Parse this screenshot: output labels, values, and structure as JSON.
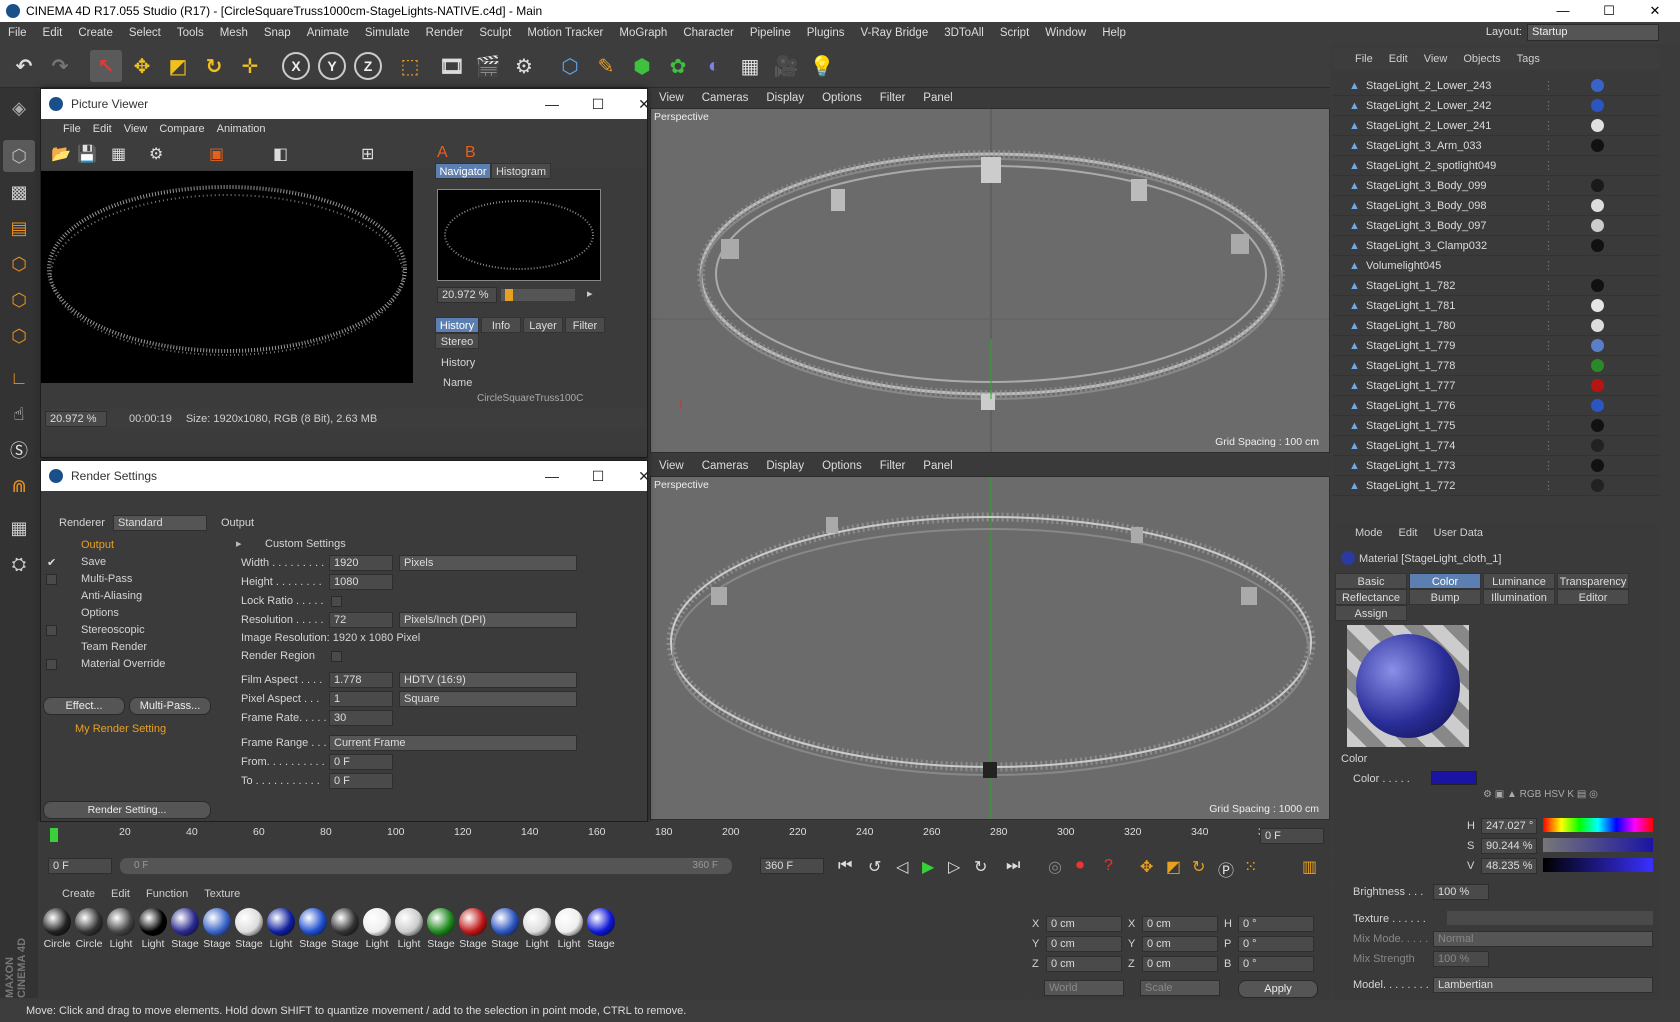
{
  "app": {
    "title": "CINEMA 4D R17.055 Studio (R17) - [CircleSquareTruss1000cm-StageLights-NATIVE.c4d] - Main",
    "min": "—",
    "max": "☐",
    "close": "✕"
  },
  "menu": [
    "File",
    "Edit",
    "Create",
    "Select",
    "Tools",
    "Mesh",
    "Snap",
    "Animate",
    "Simulate",
    "Render",
    "Sculpt",
    "Motion Tracker",
    "MoGraph",
    "Character",
    "Pipeline",
    "Plugins",
    "V-Ray Bridge",
    "3DToAll",
    "Script",
    "Window",
    "Help"
  ],
  "layout": {
    "label": "Layout:",
    "value": "Startup"
  },
  "toolbar": {
    "x": "X",
    "y": "Y",
    "z": "Z"
  },
  "viewport_top": {
    "menu": [
      "View",
      "Cameras",
      "Display",
      "Options",
      "Filter",
      "Panel"
    ],
    "label": "Perspective",
    "grid": "Grid Spacing : 100 cm"
  },
  "viewport_bottom": {
    "menu": [
      "View",
      "Cameras",
      "Display",
      "Options",
      "Filter",
      "Panel"
    ],
    "label": "Perspective",
    "grid": "Grid Spacing : 1000 cm"
  },
  "picture_viewer": {
    "title": "Picture Viewer",
    "menu": [
      "File",
      "Edit",
      "View",
      "Compare",
      "Animation"
    ],
    "tabs": [
      "Navigator",
      "Histogram"
    ],
    "zoom": "20.972 %",
    "tabs2": [
      "History",
      "Info",
      "Layer",
      "Filter"
    ],
    "stereo": "Stereo",
    "history": "History",
    "name_col": "Name",
    "history_item": "CircleSquareTruss100C",
    "status_zoom": "20.972 %",
    "status_time": "00:00:19",
    "status_size": "Size: 1920x1080, RGB (8 Bit), 2.63 MB",
    "min": "—",
    "max": "☐",
    "close": "✕"
  },
  "render_settings": {
    "title": "Render Settings",
    "renderer_label": "Renderer",
    "renderer": "Standard",
    "tree": [
      "Output",
      "Save",
      "Multi-Pass",
      "Anti-Aliasing",
      "Options",
      "Stereoscopic",
      "Team Render",
      "Material Override"
    ],
    "effect_btn": "Effect...",
    "multipass_btn": "Multi-Pass...",
    "my_setting": "My Render Setting",
    "render_setting_btn": "Render Setting...",
    "section": "Output",
    "custom": "Custom Settings",
    "width_lbl": "Width . . . . . . . . .",
    "width": "1920",
    "width_unit": "Pixels",
    "height_lbl": "Height . . . . . . . .",
    "height": "1080",
    "lock_lbl": "Lock Ratio . . . . .",
    "res_lbl": "Resolution . . . . .",
    "res": "72",
    "res_unit": "Pixels/Inch (DPI)",
    "image_res": "Image Resolution:  1920 x 1080 Pixel",
    "region_lbl": "Render Region",
    "film_lbl": "Film Aspect . . . .",
    "film": "1.778",
    "film_sel": "HDTV (16:9)",
    "pixel_lbl": "Pixel Aspect . . .",
    "pixel": "1",
    "pixel_sel": "Square",
    "fps_lbl": "Frame Rate. . . . .",
    "fps": "30",
    "range_lbl": "Frame Range . . . .",
    "range": "Current Frame",
    "from_lbl": "From. . . . . . . . . .",
    "from": "0 F",
    "to_lbl": "To . . . . . . . . . . .",
    "to": "0 F",
    "min": "—",
    "max": "☐",
    "close": "✕"
  },
  "objects": {
    "menu": [
      "File",
      "Edit",
      "View",
      "Objects",
      "Tags"
    ],
    "items": [
      "StageLight_2_Lower_243",
      "StageLight_2_Lower_242",
      "StageLight_2_Lower_241",
      "StageLight_3_Arm_033",
      "StageLight_2_spotlight049",
      "StageLight_3_Body_099",
      "StageLight_3_Body_098",
      "StageLight_3_Body_097",
      "StageLight_3_Clamp032",
      "Volumelight045",
      "StageLight_1_782",
      "StageLight_1_781",
      "StageLight_1_780",
      "StageLight_1_779",
      "StageLight_1_778",
      "StageLight_1_777",
      "StageLight_1_776",
      "StageLight_1_775",
      "StageLight_1_774",
      "StageLight_1_773",
      "StageLight_1_772"
    ],
    "tag_colors": [
      "#3a63c8",
      "#2b55c0",
      "#e0e0e0",
      "#111111",
      "",
      "#1a1a1a",
      "#dddddd",
      "#cccccc",
      "#111111",
      "",
      "#111111",
      "#e5e5e5",
      "#dddddd",
      "#5a7fc8",
      "#2a8a2a",
      "#b81414",
      "#2b55c0",
      "#111111",
      "#222222",
      "#111111",
      "#222222"
    ]
  },
  "attributes": {
    "menu": [
      "Mode",
      "Edit",
      "User Data"
    ],
    "material": "Material [StageLight_cloth_1]",
    "tabs": [
      "Basic",
      "Color",
      "Luminance",
      "Transparency",
      "Reflectance",
      "Bump",
      "Illumination",
      "Editor",
      "Assign"
    ],
    "section": "Color",
    "color_lbl": "Color . . . . .",
    "h_lbl": "H",
    "h": "247.027 °",
    "s_lbl": "S",
    "s": "90.244 %",
    "v_lbl": "V",
    "v": "48.235 %",
    "brightness_lbl": "Brightness . . .",
    "brightness": "100 %",
    "texture_lbl": "Texture . . . . . .",
    "mixmode_lbl": "Mix Mode. . . . .",
    "mixmode": "Normal",
    "mixstrength_lbl": "Mix Strength",
    "mixstrength": "100 %",
    "model_lbl": "Model. . . . . . . .",
    "model": "Lambertian",
    "swatch": "#1b14a3"
  },
  "timeline": {
    "ticks": [
      "0",
      "20",
      "40",
      "60",
      "80",
      "100",
      "120",
      "140",
      "160",
      "180",
      "200",
      "220",
      "240",
      "260",
      "280",
      "300",
      "320",
      "340",
      "360"
    ],
    "frame": "0 F"
  },
  "transport": {
    "start": "0 F",
    "range_start": "0 F",
    "range_end": "360 F",
    "end": "360 F"
  },
  "materials": {
    "menu": [
      "Create",
      "Edit",
      "Function",
      "Texture"
    ],
    "items": [
      {
        "name": "Circle",
        "color": "#222"
      },
      {
        "name": "Circle",
        "color": "#333"
      },
      {
        "name": "Light",
        "color": "#444"
      },
      {
        "name": "Light",
        "color": "#000"
      },
      {
        "name": "Stage",
        "color": "#2a2a90"
      },
      {
        "name": "Stage",
        "color": "#3a64c8"
      },
      {
        "name": "Stage",
        "color": "#ddd"
      },
      {
        "name": "Light",
        "color": "#1020a0"
      },
      {
        "name": "Stage",
        "color": "#2050d0"
      },
      {
        "name": "Stage",
        "color": "#333"
      },
      {
        "name": "Light",
        "color": "#eee"
      },
      {
        "name": "Light",
        "color": "#ccc"
      },
      {
        "name": "Stage",
        "color": "#1d8a1d"
      },
      {
        "name": "Stage",
        "color": "#c01616"
      },
      {
        "name": "Stage",
        "color": "#2b55c0"
      },
      {
        "name": "Light",
        "color": "#ddd"
      },
      {
        "name": "Light",
        "color": "#eee"
      },
      {
        "name": "Stage",
        "color": "#1018d8"
      }
    ]
  },
  "coords": {
    "x": "0 cm",
    "y": "0 cm",
    "z": "0 cm",
    "px": "0 cm",
    "py": "0 cm",
    "pz": "0 cm",
    "h": "0 °",
    "p": "0 °",
    "b": "0 °",
    "world": "World",
    "scale": "Scale",
    "apply": "Apply"
  },
  "status": "Move: Click and drag to move elements. Hold down SHIFT to quantize movement / add to the selection in point mode, CTRL to remove.",
  "brand": "MAXON CINEMA 4D"
}
